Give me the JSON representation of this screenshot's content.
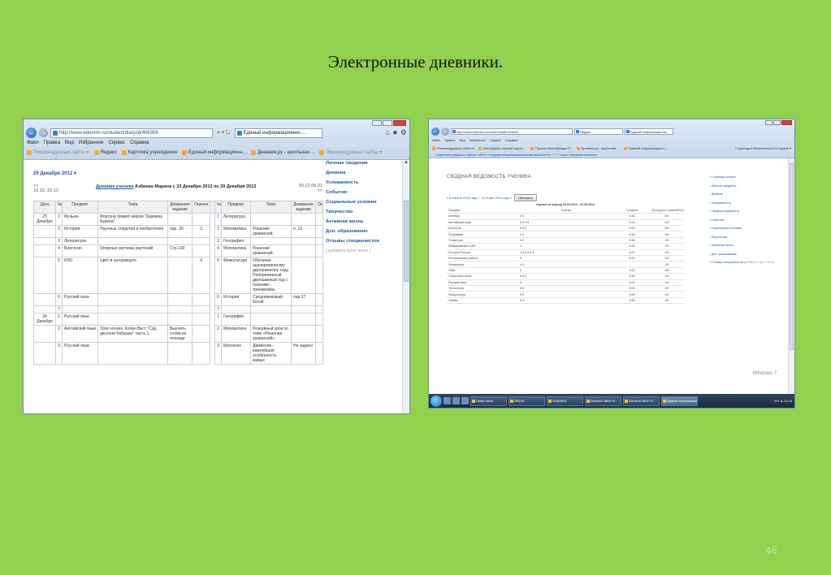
{
  "slide": {
    "title": "Электронные дневники.",
    "page_number": "46"
  },
  "shot1": {
    "address": "http://www.edumim.ru/student/diary/id/406359",
    "tab": "Единый информационно-...",
    "menu": [
      "Файл",
      "Правка",
      "Вид",
      "Избранное",
      "Сервис",
      "Справка"
    ],
    "favorites": [
      {
        "label": "Рекомендуемые сайты ▾",
        "faded": true
      },
      {
        "label": "Яндекс",
        "faded": false
      },
      {
        "label": "Карточка учреждения",
        "faded": false
      },
      {
        "label": "Единый информационн...",
        "faded": false
      },
      {
        "label": "Дневник.ру - школьная ...",
        "faded": false
      },
      {
        "label": "Рекомендуемые сайты ▾",
        "faded": true
      }
    ],
    "date_link": "29 Декабря 2013 ▾",
    "prev_week": "<< 16.12.-22.12",
    "caption_link": "Дневник ученика",
    "caption_rest": " Азбиева Марина с 23 Декабря 2013 по 29 Декабря 2013",
    "next_week": "30.12-05.01 >>",
    "sidebar": [
      "Личные сведения",
      "Дневник",
      "Успеваемость",
      "События",
      "Социальные условия",
      "Творчество",
      "Активная жизнь",
      "Доп. образование",
      "Отзывы специалистов",
      "[ добавить пункт меню ]"
    ],
    "table_headers": [
      "Дата",
      "№",
      "Предмет",
      "Тема",
      "Домашнее задание",
      "Оценка",
      "№",
      "Предмет",
      "Тема",
      "Домашнее задание",
      "Оц"
    ],
    "rows": [
      {
        "date": "23 Декабря",
        "n": "1",
        "subj": "Музыка",
        "topic": "Фортуна правит миром \"Кармина Бурана\"",
        "hw": "",
        "mark": "",
        "n2": "1",
        "subj2": "Литература",
        "topic2": "",
        "hw2": ""
      },
      {
        "date": "",
        "n": "2",
        "subj": "История",
        "topic": "Научные открытия и изобретения",
        "hw": "пар. 30",
        "mark": "3",
        "n2": "2",
        "subj2": "Математика",
        "topic2": "Решение уравнений.",
        "hw2": "п. 19"
      },
      {
        "date": "",
        "n": "3",
        "subj": "Литература",
        "topic": "",
        "hw": "",
        "mark": "",
        "n2": "3",
        "subj2": "География",
        "topic2": "",
        "hw2": ""
      },
      {
        "date": "",
        "n": "4",
        "subj": "Биология",
        "topic": "Опорные системы растений",
        "hw": "Стр.100",
        "mark": "",
        "n2": "4",
        "subj2": "Математика",
        "topic2": "Решение уравнений.",
        "hw2": ""
      },
      {
        "date": "",
        "n": "5",
        "subj": "ИЗО",
        "topic": "Цвет в натюрморте.",
        "hw": "",
        "mark": "4",
        "n2": "5",
        "subj2": "Физкультура",
        "topic2": "Обучение одновременному двухшажному ходу. Попеременный двухшажный ход с палками - тренировка.",
        "hw2": ""
      },
      {
        "date": "",
        "n": "6",
        "subj": "Русский язык",
        "topic": "",
        "hw": "",
        "mark": "",
        "n2": "6",
        "subj2": "История",
        "topic2": "Средневековый Китай",
        "hw2": "пар.37"
      },
      {
        "date": "",
        "n": "7",
        "subj": "",
        "topic": "",
        "hw": "",
        "mark": "",
        "n2": "7",
        "subj2": "",
        "topic2": "",
        "hw2": ""
      },
      {
        "date": "24 Декабря",
        "n": "1",
        "subj": "Русский язык",
        "topic": "",
        "hw": "",
        "mark": "",
        "n2": "1",
        "subj2": "География",
        "topic2": "",
        "hw2": ""
      },
      {
        "date": "",
        "n": "2",
        "subj": "Английский язык",
        "topic": "Урок чтения. Колин Вест \"Сэр, джунгли бабушки\" часть 1.",
        "hw": "Выучить слова из тетради",
        "mark": "",
        "n2": "2",
        "subj2": "Математика",
        "topic2": "Резервный урок по теме «Решение уравнений».",
        "hw2": ""
      },
      {
        "date": "",
        "n": "3",
        "subj": "Русский язык",
        "topic": "",
        "hw": "",
        "mark": "",
        "n2": "3",
        "subj2": "Биология",
        "topic2": "Движение - важнейшая особенность живых",
        "hw2": "Не задано"
      }
    ]
  },
  "shot2": {
    "address": "http://www.edumim.ru/student/statement/id",
    "tab": "Единый информационн...",
    "tab_extra": "Яндекс",
    "menu": [
      "Файл",
      "Правка",
      "Вид",
      "Избранное",
      "Сервис",
      "Справка"
    ],
    "favorites": [
      "Рекомендуемые сайты ▾",
      "Интерфейс горячей линии ...",
      "Приказ Минобрнауки Р...",
      "Дневник.ру - школьная ...",
      "Единый информационн..."
    ],
    "toolbar_right": "Страница ▾   Безопасность ▾   Сервис ▾",
    "breadcrumb": "Отделение учащихся / Школы / МБОУ «Средняя общеобразовательная школа №78» / 7 \"Г\" класс / Бирюкова Ангелина",
    "heading": "СВОДНАЯ ВЕДОМОСТЬ УЧЕНИКА",
    "period_from": "« 5 апреля 2014 года »",
    "period_to": "по 6 мая 2014 года »",
    "period_button": "Обновить",
    "period_caption": "Оценки за период 05.04.2014 - 06.05.2014",
    "columns": [
      "Предмет",
      "Оценки",
      "Средняя",
      "Пропущено занятий/Уроков"
    ],
    "rows": [
      {
        "subject": "Алгебра",
        "marks": "4 5",
        "avg": "4.50",
        "skip": "0/0"
      },
      {
        "subject": "Английский язык",
        "marks": "5 5 4 5",
        "avg": "5.00",
        "skip": "0/0"
      },
      {
        "subject": "Биология",
        "marks": "5 5 5",
        "avg": "5.00",
        "skip": "0/0"
      },
      {
        "subject": "География",
        "marks": "4 4",
        "avg": "4.50",
        "skip": "0/0"
      },
      {
        "subject": "Геометрия",
        "marks": "4 5",
        "avg": "4.50",
        "skip": "0/0"
      },
      {
        "subject": "Информатика и ИКТ",
        "marks": "4",
        "avg": "4.00",
        "skip": "0/0"
      },
      {
        "subject": "История России",
        "marks": "4 4 5 5 4 4",
        "avg": "4.67",
        "skip": "0/0"
      },
      {
        "subject": "Историческая работа",
        "marks": "5",
        "avg": "5.00",
        "skip": "0/0"
      },
      {
        "subject": "Литература",
        "marks": "4 4",
        "avg": "",
        "skip": "2/0"
      },
      {
        "subject": "ОБЖ",
        "marks": "5",
        "avg": "5.00",
        "skip": "0/0"
      },
      {
        "subject": "Обществознание",
        "marks": "4 5 4",
        "avg": "4.50",
        "skip": "0/0"
      },
      {
        "subject": "Русский язык",
        "marks": "4",
        "avg": "4.00",
        "skip": "0/0"
      },
      {
        "subject": "Технология",
        "marks": "5 5",
        "avg": "5.00",
        "skip": "0/0"
      },
      {
        "subject": "Физкультура",
        "marks": "5 5",
        "avg": "5.00",
        "skip": "0/0"
      },
      {
        "subject": "Химия",
        "marks": "5 4",
        "avg": "4.50",
        "skip": "0/0"
      }
    ],
    "sidebar": [
      "Страница класса",
      "Личные сведения",
      "Дневник",
      "Успеваемость",
      "Сводная ведомость",
      "События",
      "Социальные условия",
      "Творчество",
      "Активная жизнь",
      "Доп. образование",
      "Отзывы специалистов"
    ],
    "sidebar_extra": "добавить пункт меню",
    "windows_label": "Windows 7",
    "taskbar": [
      "Новая папка",
      "DNEVN",
      "SRAVNEN",
      "Microsoft Office Po...",
      "Microsoft Office Po...",
      "Единый информацион..."
    ],
    "tray": "EN ▲ 11:18"
  }
}
